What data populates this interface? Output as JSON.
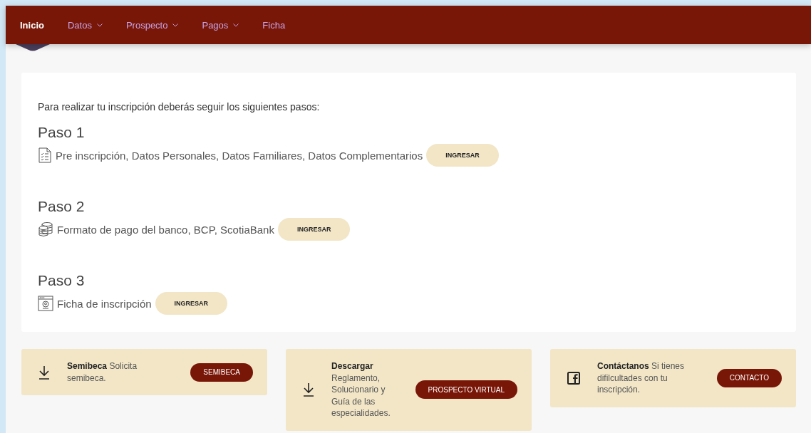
{
  "nav": [
    {
      "label": "Inicio",
      "selected": true,
      "dropdown": false
    },
    {
      "label": "Datos",
      "selected": false,
      "dropdown": true
    },
    {
      "label": "Prospecto",
      "selected": false,
      "dropdown": true
    },
    {
      "label": "Pagos",
      "selected": false,
      "dropdown": true
    },
    {
      "label": "Ficha",
      "selected": false,
      "dropdown": false
    }
  ],
  "intro": "Para realizar tu inscripción deberás seguir los siguientes pasos:",
  "steps": [
    {
      "title": "Paso 1",
      "kind": "checklist",
      "text": "Pre inscripción, Datos Personales, Datos Familiares, Datos Complementarios",
      "button": "INGRESAR"
    },
    {
      "title": "Paso 2",
      "kind": "coins",
      "text": "Formato de pago del banco, BCP, ScotiaBank",
      "button": "INGRESAR"
    },
    {
      "title": "Paso 3",
      "kind": "form",
      "text": "Ficha de inscripción",
      "button": "INGRESAR"
    }
  ],
  "cards": [
    {
      "kind": "download",
      "text": "**Semibeca** Solicita semibeca.",
      "button": "SEMIBECA"
    },
    {
      "kind": "download",
      "text": "**Descargar** Reglamento, Solucionario y Guía de las especialidades.",
      "button": "PROSPECTO VIRTUAL"
    },
    {
      "kind": "facebook",
      "text": "**Contáctanos** Si tienes difilcultades con tu inscripción.",
      "button": "CONTACTO"
    }
  ]
}
